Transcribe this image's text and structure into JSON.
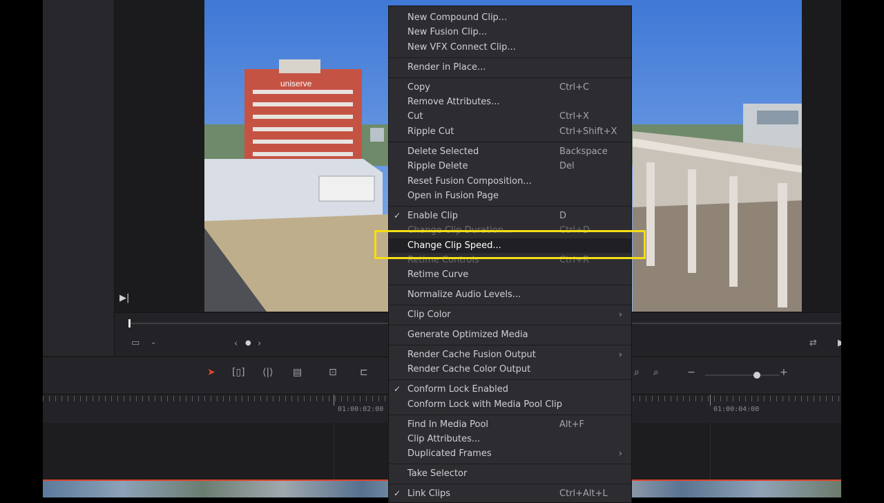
{
  "colors": {
    "panel_bg": "#1f1f22",
    "menu_bg": "#2d2d31",
    "highlight_outline": "#f6de14",
    "playhead_red": "#e0442c",
    "selection_arrow": "#e0442c"
  },
  "viewer": {
    "building_sign": "uniserve"
  },
  "timeline": {
    "timecodes": [
      "01:00:02:00",
      "01:00:04:00"
    ]
  },
  "toolbar": {
    "zoom_minus": "−",
    "zoom_plus": "+"
  },
  "menu": {
    "groups": [
      [
        {
          "label": "New Compound Clip...",
          "shortcut": ""
        },
        {
          "label": "New Fusion Clip...",
          "shortcut": ""
        },
        {
          "label": "New VFX Connect Clip...",
          "shortcut": ""
        }
      ],
      [
        {
          "label": "Render in Place...",
          "shortcut": ""
        }
      ],
      [
        {
          "label": "Copy",
          "shortcut": "Ctrl+C"
        },
        {
          "label": "Remove Attributes...",
          "shortcut": ""
        },
        {
          "label": "Cut",
          "shortcut": "Ctrl+X"
        },
        {
          "label": "Ripple Cut",
          "shortcut": "Ctrl+Shift+X"
        }
      ],
      [
        {
          "label": "Delete Selected",
          "shortcut": "Backspace"
        },
        {
          "label": "Ripple Delete",
          "shortcut": "Del"
        },
        {
          "label": "Reset Fusion Composition...",
          "shortcut": ""
        },
        {
          "label": "Open in Fusion Page",
          "shortcut": ""
        }
      ],
      [
        {
          "label": "Enable Clip",
          "shortcut": "D",
          "checked": true
        },
        {
          "label": "Change Clip Duration...",
          "shortcut": "Ctrl+D"
        },
        {
          "label": "Change Clip Speed...",
          "shortcut": "",
          "highlighted": true
        },
        {
          "label": "Retime Controls",
          "shortcut": "Ctrl+R"
        },
        {
          "label": "Retime Curve",
          "shortcut": ""
        }
      ],
      [
        {
          "label": "Normalize Audio Levels...",
          "shortcut": ""
        }
      ],
      [
        {
          "label": "Clip Color",
          "shortcut": "",
          "submenu": true
        }
      ],
      [
        {
          "label": "Generate Optimized Media",
          "shortcut": ""
        }
      ],
      [
        {
          "label": "Render Cache Fusion Output",
          "shortcut": "",
          "submenu": true
        },
        {
          "label": "Render Cache Color Output",
          "shortcut": ""
        }
      ],
      [
        {
          "label": "Conform Lock Enabled",
          "shortcut": "",
          "checked": true
        },
        {
          "label": "Conform Lock with Media Pool Clip",
          "shortcut": ""
        }
      ],
      [
        {
          "label": "Find In Media Pool",
          "shortcut": "Alt+F"
        },
        {
          "label": "Clip Attributes...",
          "shortcut": ""
        },
        {
          "label": "Duplicated Frames",
          "shortcut": "",
          "submenu": true
        }
      ],
      [
        {
          "label": "Take Selector",
          "shortcut": ""
        }
      ],
      [
        {
          "label": "Link Clips",
          "shortcut": "Ctrl+Alt+L",
          "checked": true
        }
      ]
    ]
  }
}
